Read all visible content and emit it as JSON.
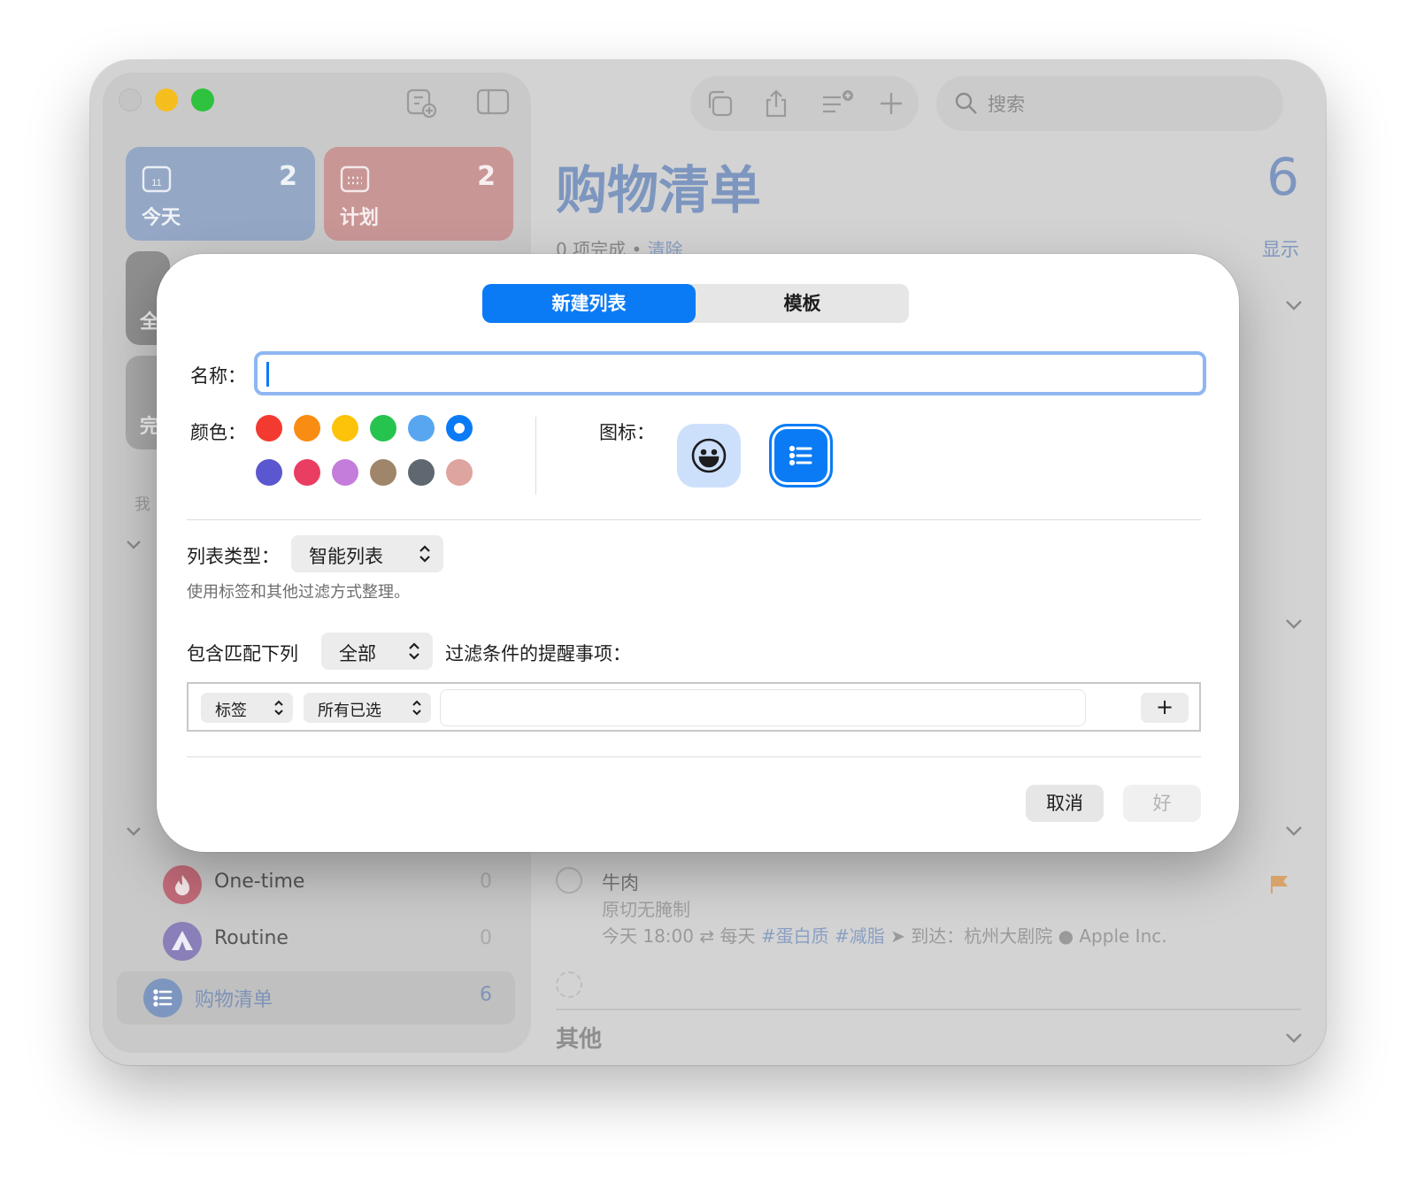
{
  "sidebar": {
    "smart_lists": [
      {
        "label": "今天",
        "count": "2",
        "icon": "calendar-today-icon",
        "date_number": "11"
      },
      {
        "label": "计划",
        "count": "2",
        "icon": "calendar-grid-icon"
      },
      {
        "label": "全",
        "icon": "tray-icon"
      },
      {
        "label": "完",
        "icon": "checkmark-icon"
      }
    ],
    "section_label": "我",
    "lists": [
      {
        "label": "One-time",
        "count": "0",
        "icon": "flame-icon",
        "color": "#c26b79"
      },
      {
        "label": "Routine",
        "count": "0",
        "icon": "tent-icon",
        "color": "#8a7fb8"
      },
      {
        "label": "购物清单",
        "count": "6",
        "icon": "list-icon",
        "color": "#7d96bf",
        "selected": true
      }
    ]
  },
  "toolbar": {
    "search_placeholder": "搜索"
  },
  "main": {
    "title": "购物清单",
    "count": "6",
    "completed_text": "0 项完成",
    "separator": "•",
    "clear_label": "清除",
    "show_label": "显示",
    "task": {
      "title": "牛肉",
      "note": "原切无腌制",
      "time": "今天 18:00",
      "repeat": "每天",
      "tags": "#蛋白质 #减脂",
      "location": "到达：杭州大剧院",
      "assignee": "Apple Inc."
    },
    "section_other": "其他"
  },
  "dialog": {
    "tabs": [
      {
        "label": "新建列表",
        "active": true
      },
      {
        "label": "模板",
        "active": false
      }
    ],
    "name_label": "名称：",
    "name_value": "",
    "color_label": "颜色：",
    "icon_label": "图标：",
    "colors_row1": [
      "#f23a30",
      "#f98c12",
      "#fcc30a",
      "#27c34f",
      "#57a6ef",
      "#0a7bf5"
    ],
    "colors_row2": [
      "#5b57d1",
      "#ea3d62",
      "#c47ddb",
      "#9f8569",
      "#5f6770",
      "#dea4a0"
    ],
    "selected_color": "#0a7bf5",
    "icons": [
      {
        "name": "smiley-icon"
      },
      {
        "name": "list-icon",
        "selected": true
      }
    ],
    "list_type_label": "列表类型：",
    "list_type_value": "智能列表",
    "list_type_hint": "使用标签和其他过滤方式整理。",
    "include_prefix": "包含匹配下列",
    "match_value": "全部",
    "include_suffix": "过滤条件的提醒事项：",
    "filter": {
      "field": "标签",
      "operator": "所有已选",
      "value": "",
      "add_label": "+"
    },
    "cancel_label": "取消",
    "ok_label": "好"
  }
}
